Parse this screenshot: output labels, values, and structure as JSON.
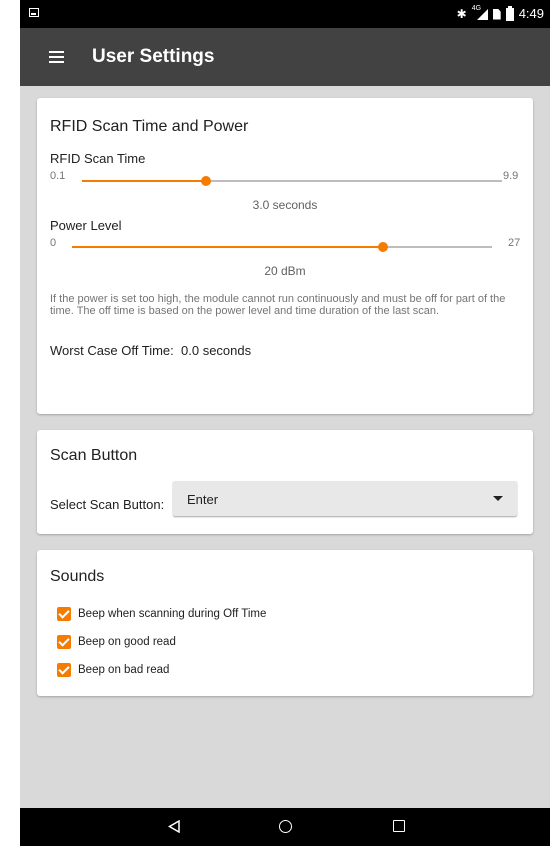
{
  "status_bar": {
    "time": "4:49",
    "network_label": "4G",
    "icons": [
      "image-icon",
      "bluetooth-icon",
      "signal-icon",
      "sim-icon",
      "battery-icon"
    ]
  },
  "toolbar": {
    "title": "User Settings",
    "menu_icon": "hamburger-menu-icon"
  },
  "rfid_card": {
    "title": "RFID Scan Time and Power",
    "scan_time": {
      "label": "RFID Scan Time",
      "min_label": "0.1",
      "max_label": "9.9",
      "min": 0.1,
      "max": 9.9,
      "value": 3.0,
      "value_text": "3.0 seconds"
    },
    "power_level": {
      "label": "Power Level",
      "min_label": "0",
      "max_label": "27",
      "min": 0,
      "max": 27,
      "value": 20,
      "value_text": "20 dBm"
    },
    "warning": "If the power is set too high, the module cannot run continuously and must be off for part of the time. The off time is based on the power level and time duration of the last scan.",
    "off_time_label": "Worst Case Off Time:",
    "off_time_value": "0.0 seconds"
  },
  "scan_card": {
    "title": "Scan Button",
    "select_label": "Select Scan Button:",
    "selected": "Enter"
  },
  "sounds_card": {
    "title": "Sounds",
    "options": [
      {
        "label": "Beep when scanning during Off Time",
        "checked": true
      },
      {
        "label": "Beep on good read",
        "checked": true
      },
      {
        "label": "Beep on bad read",
        "checked": true
      }
    ]
  },
  "nav_bar": {
    "icons": [
      "back-icon",
      "home-icon",
      "recents-icon"
    ]
  },
  "colors": {
    "accent": "#f57c00",
    "toolbar": "#424242",
    "background": "#d9d9d9",
    "status_bar": "#000000"
  }
}
